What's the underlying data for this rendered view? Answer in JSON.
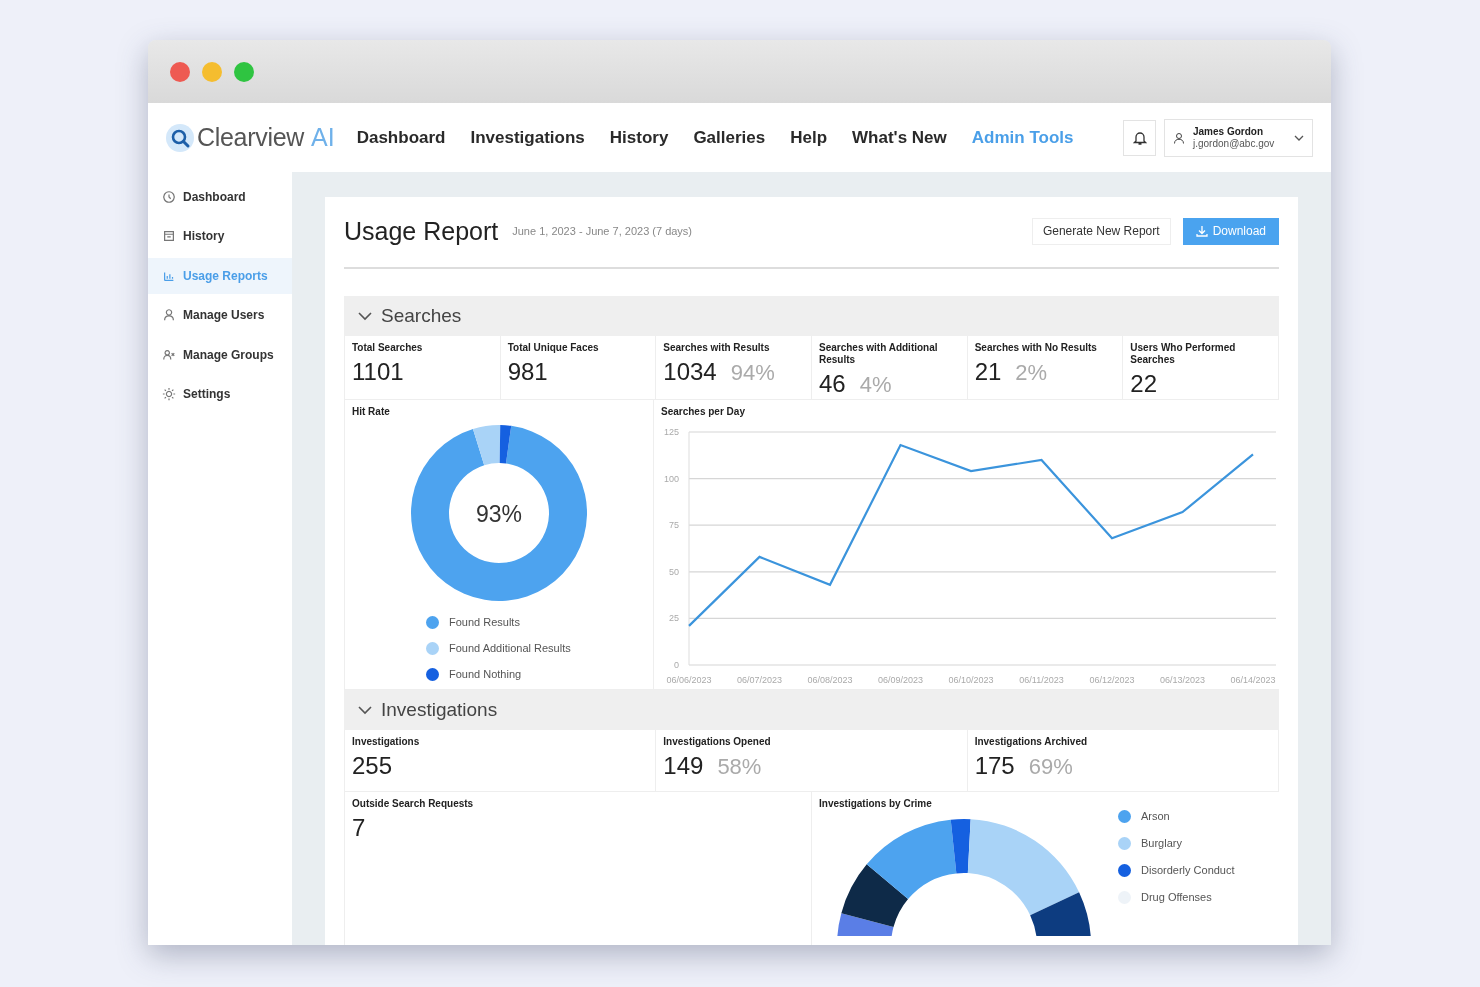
{
  "window": {
    "controls": [
      {
        "color": "#ee5a52"
      },
      {
        "color": "#f5bd2f"
      },
      {
        "color": "#2fc441"
      }
    ]
  },
  "app_bar": {
    "logo_name": "Clearview",
    "logo_suffix": "AI",
    "nav": [
      {
        "label": "Dashboard",
        "selected": false
      },
      {
        "label": "Investigations",
        "selected": false
      },
      {
        "label": "History",
        "selected": false
      },
      {
        "label": "Galleries",
        "selected": false
      },
      {
        "label": "Help",
        "selected": false
      },
      {
        "label": "What's New",
        "selected": false
      },
      {
        "label": "Admin Tools",
        "selected": true
      }
    ],
    "user": {
      "name": "James Gordon",
      "email": "j.gordon@abc.gov"
    }
  },
  "sidebar": {
    "items": [
      {
        "label": "Dashboard",
        "selected": false
      },
      {
        "label": "History",
        "selected": false
      },
      {
        "label": "Usage Reports",
        "selected": true
      },
      {
        "label": "Manage Users",
        "selected": false
      },
      {
        "label": "Manage Groups",
        "selected": false
      },
      {
        "label": "Settings",
        "selected": false
      }
    ]
  },
  "report": {
    "title": "Usage Report",
    "date_range": "June 1, 2023 - June 7, 2023 (7 days)",
    "buttons": [
      {
        "label": "Generate New Report",
        "kind": "secondary"
      },
      {
        "label": "Download",
        "kind": "primary"
      }
    ]
  },
  "searches": {
    "title": "Searches",
    "expanded": true,
    "stats": [
      {
        "label": "Total Searches",
        "value": "1101"
      },
      {
        "label": "Total Unique Faces",
        "value": "981"
      },
      {
        "label": "Searches with Results",
        "value": "1034",
        "percent": "94%"
      },
      {
        "label": "Searches with Additional Results",
        "value": "46",
        "percent": "4%"
      },
      {
        "label": "Searches with No Results",
        "value": "21",
        "percent": "2%"
      },
      {
        "label": "Users Who Performed Searches",
        "value": "22"
      }
    ],
    "hit_rate": {
      "title": "Hit Rate",
      "center_label": "93%",
      "legend": [
        {
          "label": "Found Results",
          "color": "#4da3ef"
        },
        {
          "label": "Found Additional Results",
          "color": "#a9d3f7"
        },
        {
          "label": "Found Nothing",
          "color": "#1560e0"
        }
      ],
      "chart_data": {
        "type": "donut",
        "values": [
          93,
          5,
          2
        ]
      }
    },
    "per_day": {
      "chart_data": {
        "type": "line",
        "title": "Searches per Day",
        "x": [
          "06/06/2023",
          "06/07/2023",
          "06/08/2023",
          "06/09/2023",
          "06/10/2023",
          "06/11/2023",
          "06/12/2023",
          "06/13/2023",
          "06/14/2023"
        ],
        "series": [
          {
            "color": "#3b94dc",
            "values": [
              21,
              58,
              43,
              118,
              104,
              110,
              68,
              82,
              113
            ]
          }
        ],
        "ylim": [
          0,
          125
        ],
        "yticks": [
          0,
          25,
          50,
          75,
          100,
          125
        ],
        "grid": true
      }
    }
  },
  "investigations": {
    "title": "Investigations",
    "expanded": true,
    "stats": [
      {
        "label": "Investigations",
        "value": "255"
      },
      {
        "label": "Investigations Opened",
        "value": "149",
        "percent": "58%"
      },
      {
        "label": "Investigations Archived",
        "value": "175",
        "percent": "69%"
      }
    ],
    "outside": {
      "label": "Outside Search Requests",
      "value": "7"
    },
    "by_crime": {
      "title": "Investigations by Crime",
      "legend": [
        {
          "label": "Arson",
          "color": "#4da3ef"
        },
        {
          "label": "Burglary",
          "color": "#a9d3f7"
        },
        {
          "label": "Disorderly Conduct",
          "color": "#1560e0"
        },
        {
          "label": "Drug Offenses",
          "color": "#eef3f8"
        }
      ]
    }
  }
}
